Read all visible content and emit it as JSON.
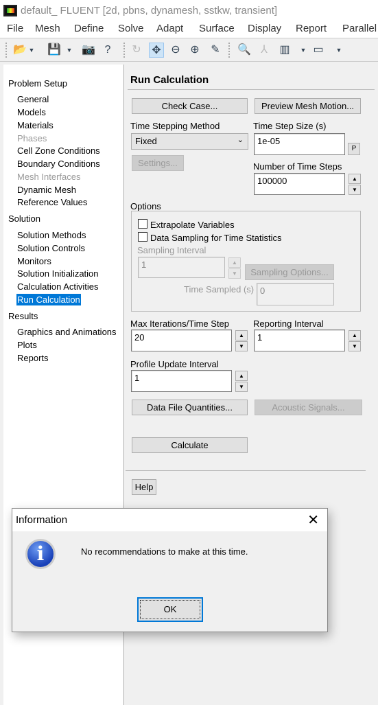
{
  "window": {
    "title": "default_ FLUENT  [2d, pbns, dynamesh, sstkw, transient]"
  },
  "menu": [
    "File",
    "Mesh",
    "Define",
    "Solve",
    "Adapt",
    "Surface",
    "Display",
    "Report",
    "Parallel"
  ],
  "toolbar": [
    "open-icon",
    "save-icon",
    "camera-icon",
    "help-icon",
    "rotate-icon",
    "move-icon",
    "zoom-fit-icon",
    "zoom-in-icon",
    "probe-icon",
    "zoom-box-icon",
    "axes-icon",
    "layout-icon",
    "view-icon"
  ],
  "nav": [
    {
      "label": "Problem Setup",
      "type": "h"
    },
    {
      "label": "General",
      "type": "i"
    },
    {
      "label": "Models",
      "type": "i"
    },
    {
      "label": "Materials",
      "type": "i"
    },
    {
      "label": "Phases",
      "type": "i",
      "disabled": true
    },
    {
      "label": "Cell Zone Conditions",
      "type": "i"
    },
    {
      "label": "Boundary Conditions",
      "type": "i"
    },
    {
      "label": "Mesh Interfaces",
      "type": "i",
      "disabled": true
    },
    {
      "label": "Dynamic Mesh",
      "type": "i"
    },
    {
      "label": "Reference Values",
      "type": "i"
    },
    {
      "label": "Solution",
      "type": "h"
    },
    {
      "label": "Solution Methods",
      "type": "i"
    },
    {
      "label": "Solution Controls",
      "type": "i"
    },
    {
      "label": "Monitors",
      "type": "i"
    },
    {
      "label": "Solution Initialization",
      "type": "i"
    },
    {
      "label": "Calculation Activities",
      "type": "i"
    },
    {
      "label": "Run Calculation",
      "type": "i",
      "selected": true
    },
    {
      "label": "Results",
      "type": "h"
    },
    {
      "label": "Graphics and Animations",
      "type": "i"
    },
    {
      "label": "Plots",
      "type": "i"
    },
    {
      "label": "Reports",
      "type": "i"
    }
  ],
  "panel": {
    "title": "Run Calculation",
    "check_case": "Check Case...",
    "preview_mesh": "Preview Mesh Motion...",
    "time_stepping_label": "Time Stepping Method",
    "time_stepping_value": "Fixed",
    "settings": "Settings...",
    "time_step_size_label": "Time Step Size (s)",
    "time_step_size": "1e-05",
    "p_button": "P",
    "num_steps_label": "Number of Time Steps",
    "num_steps": "100000",
    "options_label": "Options",
    "extrapolate": "Extrapolate Variables",
    "data_sampling": "Data Sampling for Time Statistics",
    "sampling_interval_label": "Sampling Interval",
    "sampling_interval": "1",
    "sampling_options": "Sampling Options...",
    "time_sampled_label": "Time Sampled (s)",
    "time_sampled": "0",
    "max_iter_label": "Max Iterations/Time Step",
    "max_iter": "20",
    "reporting_label": "Reporting Interval",
    "reporting": "1",
    "profile_label": "Profile Update Interval",
    "profile": "1",
    "data_file": "Data File Quantities...",
    "acoustic": "Acoustic Signals...",
    "calculate": "Calculate",
    "help": "Help"
  },
  "dialog": {
    "title": "Information",
    "message": "No recommendations to make at this time.",
    "ok": "OK"
  }
}
